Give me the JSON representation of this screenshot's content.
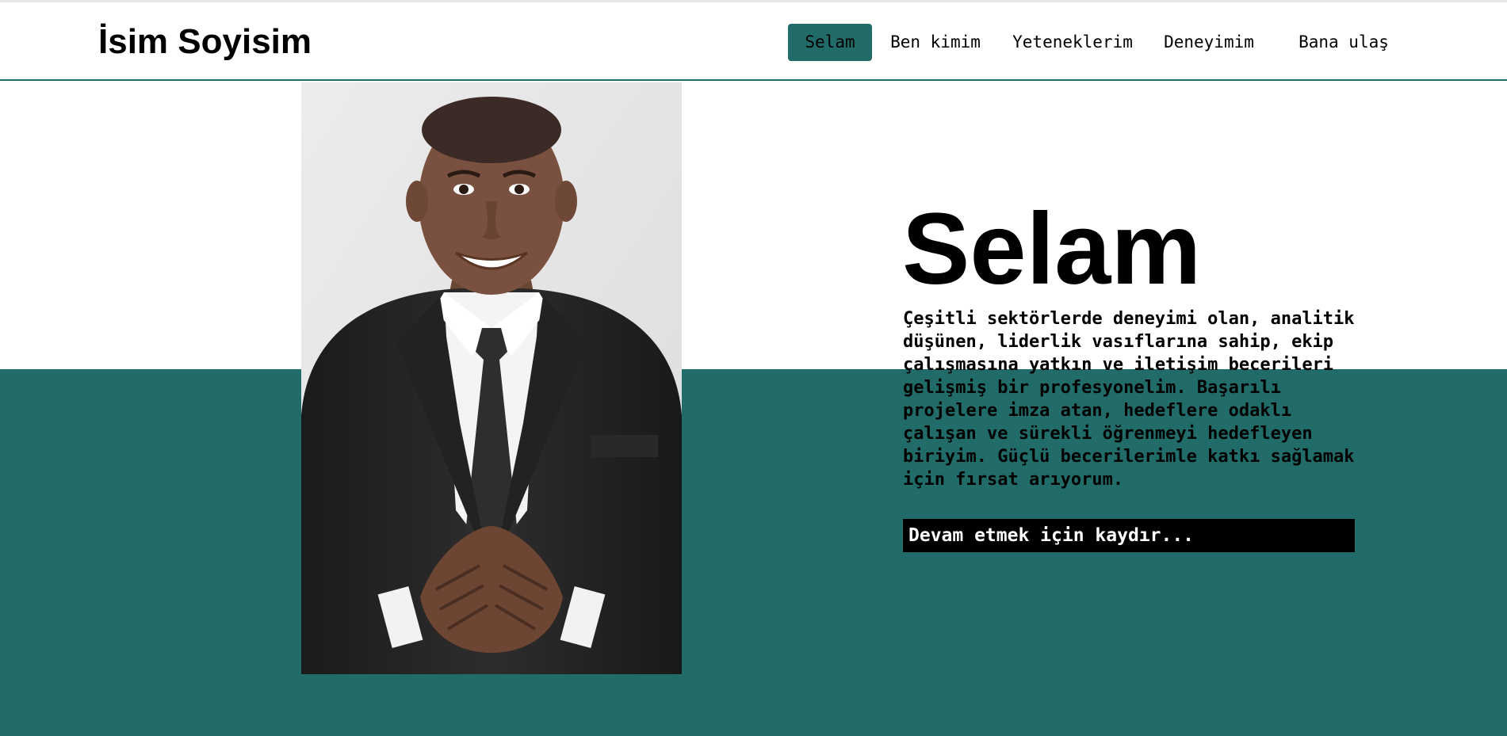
{
  "header": {
    "brand": "İsim Soyisim",
    "nav": [
      {
        "label": "Selam",
        "active": true
      },
      {
        "label": "Ben kimim",
        "active": false
      },
      {
        "label": "Yeteneklerim",
        "active": false
      },
      {
        "label": "Deneyimim",
        "active": false
      },
      {
        "label": "Bana ulaş",
        "active": false
      }
    ]
  },
  "hero": {
    "title": "Selam",
    "description": "Çeşitli sektörlerde deneyimi olan, analitik düşünen, liderlik vasıflarına sahip, ekip çalışmasına yatkın ve iletişim becerileri gelişmiş bir profesyonelim. Başarılı projelere imza atan, hedeflere odaklı çalışan ve sürekli öğrenmeyi hedefleyen biriyim. Güçlü becerilerimle katkı sağlamak için fırsat arıyorum.",
    "scroll_hint": "Devam etmek için kaydır...",
    "photo_icon": "portrait-photo"
  },
  "colors": {
    "accent": "#216b69",
    "header_border": "#216b69",
    "scroll_hint_bg": "#000000"
  }
}
